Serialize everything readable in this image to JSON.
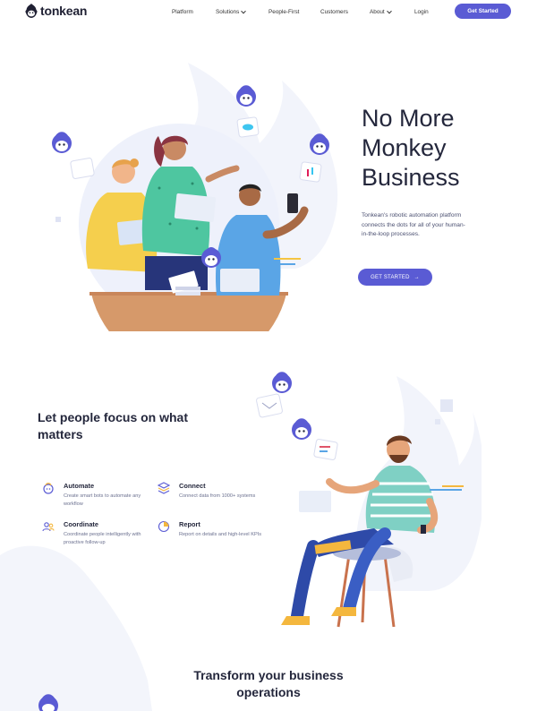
{
  "brand": {
    "name": "tonkean",
    "accent": "#5a5bd4"
  },
  "nav": {
    "items": [
      {
        "label": "Platform",
        "dropdown": false
      },
      {
        "label": "Solutions",
        "dropdown": true
      },
      {
        "label": "People-First",
        "dropdown": false
      },
      {
        "label": "Customers",
        "dropdown": false
      },
      {
        "label": "About",
        "dropdown": true
      },
      {
        "label": "Login",
        "dropdown": false
      }
    ],
    "cta_label": "Get Started"
  },
  "hero": {
    "title_lines": [
      "No More",
      "Monkey",
      "Business"
    ],
    "description": "Tonkean's robotic automation platform connects the dots for all of your human-in-the-loop processes.",
    "cta_label": "GET STARTED",
    "cta_arrow": "→"
  },
  "focus": {
    "title": "Let people focus on what matters",
    "features": [
      {
        "title": "Automate",
        "desc": "Create smart bots to automate any workflow",
        "icon": "automate-icon"
      },
      {
        "title": "Connect",
        "desc": "Connect data from 1000+ systems",
        "icon": "connect-icon"
      },
      {
        "title": "Coordinate",
        "desc": "Coordinate people intelligently with proactive follow-up",
        "icon": "coordinate-icon"
      },
      {
        "title": "Report",
        "desc": "Report on details and high-level KPIs",
        "icon": "report-icon"
      }
    ]
  },
  "transform": {
    "title": "Transform your business operations"
  }
}
